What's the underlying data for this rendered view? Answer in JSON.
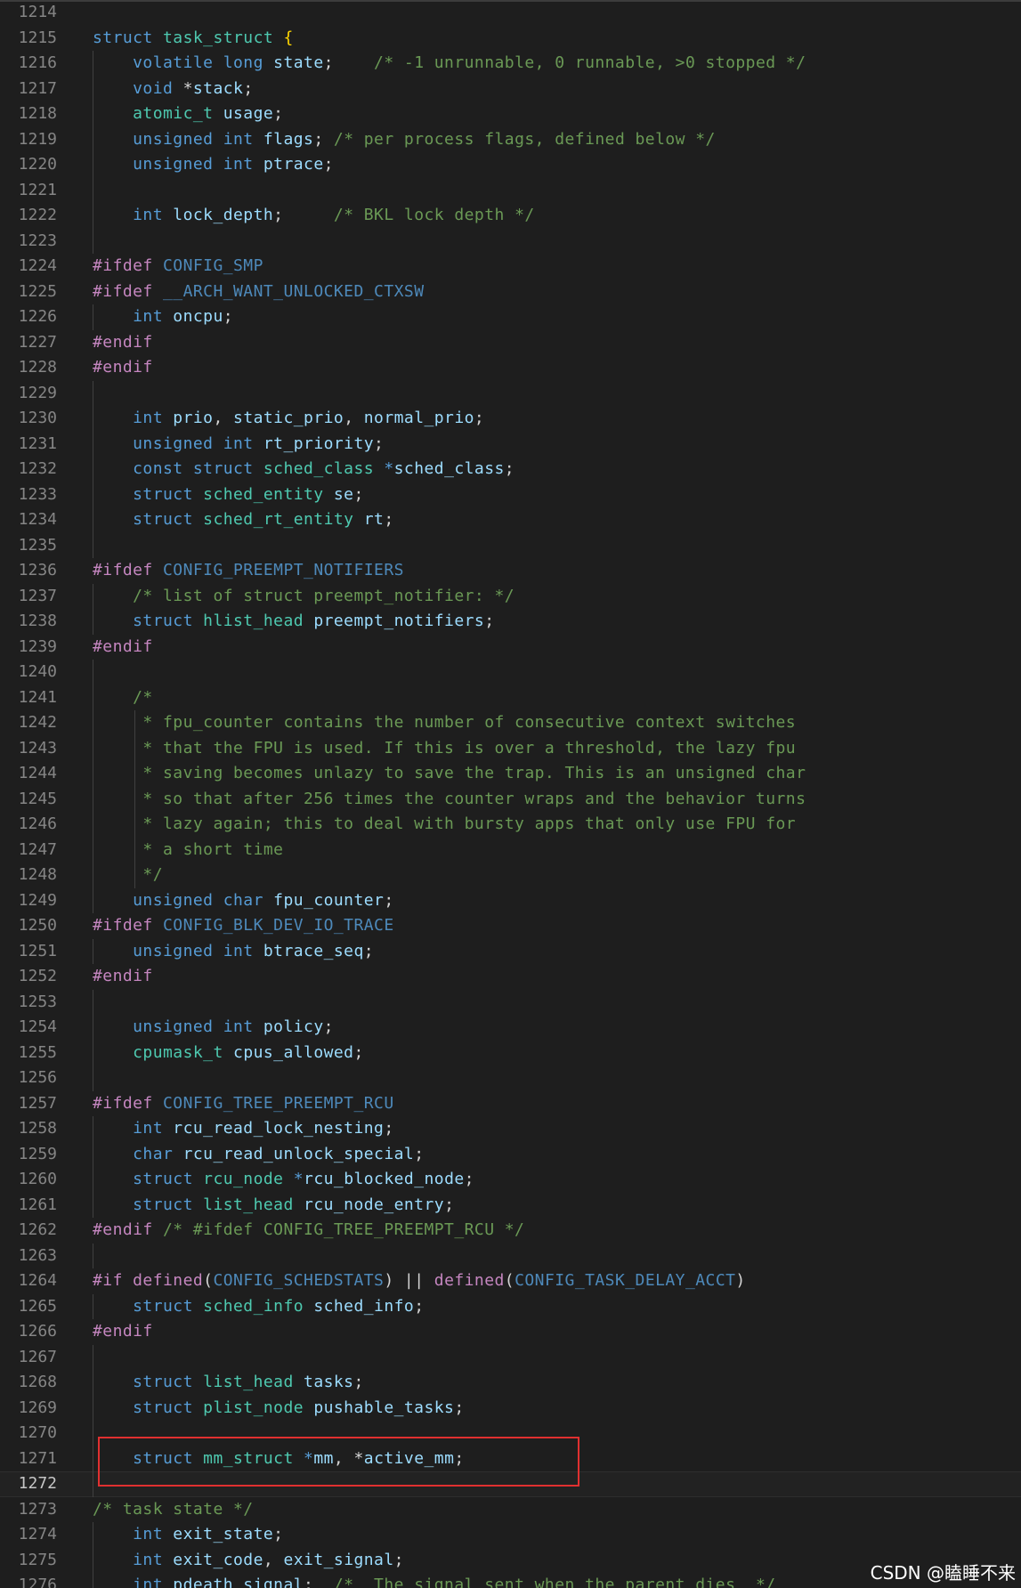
{
  "editor": {
    "watermark": "CSDN @瞌睡不来",
    "highlight_color": "#e03030",
    "current_line": "1272",
    "lines": [
      {
        "n": "1214",
        "t": []
      },
      {
        "n": "1215",
        "t": [
          [
            "kw",
            "struct "
          ],
          [
            "ty",
            "task_struct "
          ],
          [
            "br",
            "{"
          ]
        ]
      },
      {
        "n": "1216",
        "g": 1,
        "t": [
          [
            "kw",
            "    volatile long "
          ],
          [
            "va",
            "state"
          ],
          [
            "op",
            ";    "
          ],
          [
            "cm",
            "/* -1 unrunnable, 0 runnable, >0 stopped */"
          ]
        ]
      },
      {
        "n": "1217",
        "g": 1,
        "t": [
          [
            "kw",
            "    void "
          ],
          [
            "op",
            "*"
          ],
          [
            "va",
            "stack"
          ],
          [
            "op",
            ";"
          ]
        ]
      },
      {
        "n": "1218",
        "g": 1,
        "t": [
          [
            "ty",
            "    atomic_t "
          ],
          [
            "va",
            "usage"
          ],
          [
            "op",
            ";"
          ]
        ]
      },
      {
        "n": "1219",
        "g": 1,
        "t": [
          [
            "kw",
            "    unsigned int "
          ],
          [
            "va",
            "flags"
          ],
          [
            "op",
            "; "
          ],
          [
            "cm",
            "/* per process flags, defined below */"
          ]
        ]
      },
      {
        "n": "1220",
        "g": 1,
        "t": [
          [
            "kw",
            "    unsigned int "
          ],
          [
            "va",
            "ptrace"
          ],
          [
            "op",
            ";"
          ]
        ]
      },
      {
        "n": "1221",
        "g": 1,
        "t": []
      },
      {
        "n": "1222",
        "g": 1,
        "t": [
          [
            "kw",
            "    int "
          ],
          [
            "va",
            "lock_depth"
          ],
          [
            "op",
            ";     "
          ],
          [
            "cm",
            "/* BKL lock depth */"
          ]
        ]
      },
      {
        "n": "1223",
        "g": 1,
        "t": []
      },
      {
        "n": "1224",
        "t": [
          [
            "pp",
            "#ifdef "
          ],
          [
            "mc",
            "CONFIG_SMP"
          ]
        ]
      },
      {
        "n": "1225",
        "t": [
          [
            "pp",
            "#ifdef "
          ],
          [
            "mc",
            "__ARCH_WANT_UNLOCKED_CTXSW"
          ]
        ]
      },
      {
        "n": "1226",
        "g": 1,
        "t": [
          [
            "kw",
            "    int "
          ],
          [
            "va",
            "oncpu"
          ],
          [
            "op",
            ";"
          ]
        ]
      },
      {
        "n": "1227",
        "t": [
          [
            "pp",
            "#endif"
          ]
        ]
      },
      {
        "n": "1228",
        "t": [
          [
            "pp",
            "#endif"
          ]
        ]
      },
      {
        "n": "1229",
        "g": 1,
        "t": []
      },
      {
        "n": "1230",
        "g": 1,
        "t": [
          [
            "kw",
            "    int "
          ],
          [
            "va",
            "prio"
          ],
          [
            "op",
            ", "
          ],
          [
            "va",
            "static_prio"
          ],
          [
            "op",
            ", "
          ],
          [
            "va",
            "normal_prio"
          ],
          [
            "op",
            ";"
          ]
        ]
      },
      {
        "n": "1231",
        "g": 1,
        "t": [
          [
            "kw",
            "    unsigned int "
          ],
          [
            "va",
            "rt_priority"
          ],
          [
            "op",
            ";"
          ]
        ]
      },
      {
        "n": "1232",
        "g": 1,
        "t": [
          [
            "kw",
            "    const struct "
          ],
          [
            "ty",
            "sched_class "
          ],
          [
            "kw",
            "*"
          ],
          [
            "va",
            "sched_class"
          ],
          [
            "op",
            ";"
          ]
        ]
      },
      {
        "n": "1233",
        "g": 1,
        "t": [
          [
            "kw",
            "    struct "
          ],
          [
            "ty",
            "sched_entity "
          ],
          [
            "va",
            "se"
          ],
          [
            "op",
            ";"
          ]
        ]
      },
      {
        "n": "1234",
        "g": 1,
        "t": [
          [
            "kw",
            "    struct "
          ],
          [
            "ty",
            "sched_rt_entity "
          ],
          [
            "va",
            "rt"
          ],
          [
            "op",
            ";"
          ]
        ]
      },
      {
        "n": "1235",
        "g": 1,
        "t": []
      },
      {
        "n": "1236",
        "t": [
          [
            "pp",
            "#ifdef "
          ],
          [
            "mc",
            "CONFIG_PREEMPT_NOTIFIERS"
          ]
        ]
      },
      {
        "n": "1237",
        "g": 1,
        "t": [
          [
            "cm",
            "    /* list of struct preempt_notifier: */"
          ]
        ]
      },
      {
        "n": "1238",
        "g": 1,
        "t": [
          [
            "kw",
            "    struct "
          ],
          [
            "ty",
            "hlist_head "
          ],
          [
            "va",
            "preempt_notifiers"
          ],
          [
            "op",
            ";"
          ]
        ]
      },
      {
        "n": "1239",
        "t": [
          [
            "pp",
            "#endif"
          ]
        ]
      },
      {
        "n": "1240",
        "g": 1,
        "t": []
      },
      {
        "n": "1241",
        "g": 1,
        "t": [
          [
            "cm",
            "    /*"
          ]
        ]
      },
      {
        "n": "1242",
        "g": 1,
        "c": 1,
        "t": [
          [
            "cm",
            "     * fpu_counter contains the number of consecutive context switches"
          ]
        ]
      },
      {
        "n": "1243",
        "g": 1,
        "c": 1,
        "t": [
          [
            "cm",
            "     * that the FPU is used. If this is over a threshold, the lazy fpu"
          ]
        ]
      },
      {
        "n": "1244",
        "g": 1,
        "c": 1,
        "t": [
          [
            "cm",
            "     * saving becomes unlazy to save the trap. This is an unsigned char"
          ]
        ]
      },
      {
        "n": "1245",
        "g": 1,
        "c": 1,
        "t": [
          [
            "cm",
            "     * so that after 256 times the counter wraps and the behavior turns"
          ]
        ]
      },
      {
        "n": "1246",
        "g": 1,
        "c": 1,
        "t": [
          [
            "cm",
            "     * lazy again; this to deal with bursty apps that only use FPU for"
          ]
        ]
      },
      {
        "n": "1247",
        "g": 1,
        "c": 1,
        "t": [
          [
            "cm",
            "     * a short time"
          ]
        ]
      },
      {
        "n": "1248",
        "g": 1,
        "c": 1,
        "t": [
          [
            "cm",
            "     */"
          ]
        ]
      },
      {
        "n": "1249",
        "g": 1,
        "t": [
          [
            "kw",
            "    unsigned char "
          ],
          [
            "va",
            "fpu_counter"
          ],
          [
            "op",
            ";"
          ]
        ]
      },
      {
        "n": "1250",
        "t": [
          [
            "pp",
            "#ifdef "
          ],
          [
            "mc",
            "CONFIG_BLK_DEV_IO_TRACE"
          ]
        ]
      },
      {
        "n": "1251",
        "g": 1,
        "t": [
          [
            "kw",
            "    unsigned int "
          ],
          [
            "va",
            "btrace_seq"
          ],
          [
            "op",
            ";"
          ]
        ]
      },
      {
        "n": "1252",
        "t": [
          [
            "pp",
            "#endif"
          ]
        ]
      },
      {
        "n": "1253",
        "g": 1,
        "t": []
      },
      {
        "n": "1254",
        "g": 1,
        "t": [
          [
            "kw",
            "    unsigned int "
          ],
          [
            "va",
            "policy"
          ],
          [
            "op",
            ";"
          ]
        ]
      },
      {
        "n": "1255",
        "g": 1,
        "t": [
          [
            "ty",
            "    cpumask_t "
          ],
          [
            "va",
            "cpus_allowed"
          ],
          [
            "op",
            ";"
          ]
        ]
      },
      {
        "n": "1256",
        "g": 1,
        "t": []
      },
      {
        "n": "1257",
        "t": [
          [
            "pp",
            "#ifdef "
          ],
          [
            "mc",
            "CONFIG_TREE_PREEMPT_RCU"
          ]
        ]
      },
      {
        "n": "1258",
        "g": 1,
        "t": [
          [
            "kw",
            "    int "
          ],
          [
            "va",
            "rcu_read_lock_nesting"
          ],
          [
            "op",
            ";"
          ]
        ]
      },
      {
        "n": "1259",
        "g": 1,
        "t": [
          [
            "kw",
            "    char "
          ],
          [
            "va",
            "rcu_read_unlock_special"
          ],
          [
            "op",
            ";"
          ]
        ]
      },
      {
        "n": "1260",
        "g": 1,
        "t": [
          [
            "kw",
            "    struct "
          ],
          [
            "ty",
            "rcu_node "
          ],
          [
            "kw",
            "*"
          ],
          [
            "va",
            "rcu_blocked_node"
          ],
          [
            "op",
            ";"
          ]
        ]
      },
      {
        "n": "1261",
        "g": 1,
        "t": [
          [
            "kw",
            "    struct "
          ],
          [
            "ty",
            "list_head "
          ],
          [
            "va",
            "rcu_node_entry"
          ],
          [
            "op",
            ";"
          ]
        ]
      },
      {
        "n": "1262",
        "t": [
          [
            "pp",
            "#endif "
          ],
          [
            "cm",
            "/* #ifdef CONFIG_TREE_PREEMPT_RCU */"
          ]
        ]
      },
      {
        "n": "1263",
        "g": 1,
        "t": []
      },
      {
        "n": "1264",
        "t": [
          [
            "pp",
            "#if defined"
          ],
          [
            "op",
            "("
          ],
          [
            "mc",
            "CONFIG_SCHEDSTATS"
          ],
          [
            "op",
            ") || "
          ],
          [
            "pp",
            "defined"
          ],
          [
            "op",
            "("
          ],
          [
            "mc",
            "CONFIG_TASK_DELAY_ACCT"
          ],
          [
            "op",
            ")"
          ]
        ]
      },
      {
        "n": "1265",
        "g": 1,
        "t": [
          [
            "kw",
            "    struct "
          ],
          [
            "ty",
            "sched_info "
          ],
          [
            "va",
            "sched_info"
          ],
          [
            "op",
            ";"
          ]
        ]
      },
      {
        "n": "1266",
        "t": [
          [
            "pp",
            "#endif"
          ]
        ]
      },
      {
        "n": "1267",
        "g": 1,
        "t": []
      },
      {
        "n": "1268",
        "g": 1,
        "t": [
          [
            "kw",
            "    struct "
          ],
          [
            "ty",
            "list_head "
          ],
          [
            "va",
            "tasks"
          ],
          [
            "op",
            ";"
          ]
        ]
      },
      {
        "n": "1269",
        "g": 1,
        "t": [
          [
            "kw",
            "    struct "
          ],
          [
            "ty",
            "plist_node "
          ],
          [
            "va",
            "pushable_tasks"
          ],
          [
            "op",
            ";"
          ]
        ]
      },
      {
        "n": "1270",
        "g": 1,
        "t": []
      },
      {
        "n": "1271",
        "g": 1,
        "t": [
          [
            "kw",
            "    struct "
          ],
          [
            "ty",
            "mm_struct "
          ],
          [
            "kw",
            "*"
          ],
          [
            "va",
            "mm"
          ],
          [
            "op",
            ", *"
          ],
          [
            "va",
            "active_mm"
          ],
          [
            "op",
            ";"
          ]
        ]
      },
      {
        "n": "1272",
        "g": 1,
        "t": []
      },
      {
        "n": "1273",
        "t": [
          [
            "cm",
            "/* task state */"
          ]
        ]
      },
      {
        "n": "1274",
        "g": 1,
        "t": [
          [
            "kw",
            "    int "
          ],
          [
            "va",
            "exit_state"
          ],
          [
            "op",
            ";"
          ]
        ]
      },
      {
        "n": "1275",
        "g": 1,
        "t": [
          [
            "kw",
            "    int "
          ],
          [
            "va",
            "exit_code"
          ],
          [
            "op",
            ", "
          ],
          [
            "va",
            "exit_signal"
          ],
          [
            "op",
            ";"
          ]
        ]
      },
      {
        "n": "1276",
        "g": 1,
        "t": [
          [
            "kw",
            "    int "
          ],
          [
            "va",
            "pdeath_signal"
          ],
          [
            "op",
            ";  "
          ],
          [
            "cm",
            "/*  The signal sent when the parent dies  */"
          ]
        ]
      }
    ]
  }
}
